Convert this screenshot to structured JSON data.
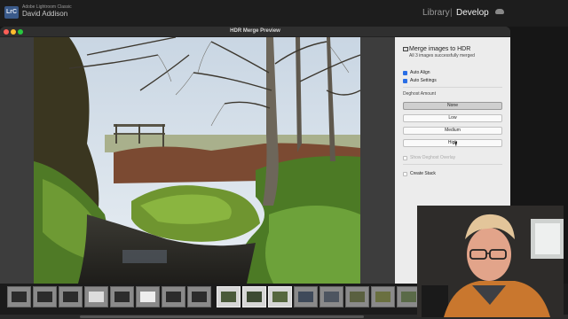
{
  "lightroom": {
    "app_label": "Adobe Lightroom Classic",
    "user_name": "David Addison",
    "badge": "LrC",
    "modules": {
      "library": "Library",
      "separator": "|",
      "develop": "Develop"
    }
  },
  "dialog": {
    "title": "HDR Merge Preview"
  },
  "settings": {
    "merge_title": "Merge images to HDR",
    "merge_status": "All 3 images successfully merged",
    "auto_align_label": "Auto Align",
    "auto_settings_label": "Auto Settings",
    "deghost_amount_label": "Deghost Amount",
    "deghost_options": [
      "None",
      "Low",
      "Medium",
      "High"
    ],
    "deghost_selected": "None",
    "show_overlay_label": "Show Deghost Overlay",
    "create_stack_label": "Create Stack"
  },
  "colors": {
    "accent": "#2a6ee5",
    "dialog_bg": "#3c3c3c",
    "panel_bg": "#ececec"
  }
}
